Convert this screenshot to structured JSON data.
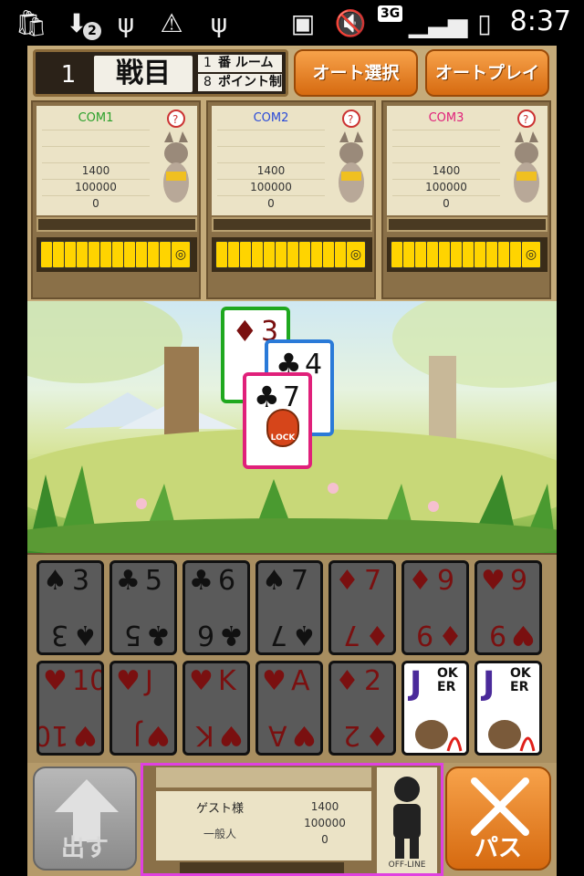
{
  "status_bar": {
    "notification_count": "2",
    "network": "3G",
    "time": "8:37"
  },
  "header": {
    "round_number": "1",
    "round_label": "戦目",
    "rule1_num": "1",
    "rule1_text": "番 ルーム",
    "rule2_num": "8",
    "rule2_text": "ポイント制",
    "auto_select_label": "オート選択",
    "auto_play_label": "オートプレイ"
  },
  "opponents": [
    {
      "name": "COM1",
      "color": "#2aa02a",
      "points": "1400",
      "money": "100000",
      "score": "0",
      "cards": 12
    },
    {
      "name": "COM2",
      "color": "#2a4ad8",
      "points": "1400",
      "money": "100000",
      "score": "0",
      "cards": 12
    },
    {
      "name": "COM3",
      "color": "#e0207a",
      "points": "1400",
      "money": "100000",
      "score": "0",
      "cards": 12
    }
  ],
  "field_cards": [
    {
      "suit": "♦",
      "rank": "3",
      "color": "red",
      "border": "#1fa81f"
    },
    {
      "suit": "♣",
      "rank": "4",
      "color": "black",
      "border": "#2a7ad8"
    },
    {
      "suit": "♣",
      "rank": "7",
      "color": "black",
      "border": "#e0207a",
      "lock": "LOCK"
    }
  ],
  "hand": [
    {
      "suit": "♠",
      "rank": "3",
      "color": "black"
    },
    {
      "suit": "♣",
      "rank": "5",
      "color": "black"
    },
    {
      "suit": "♣",
      "rank": "6",
      "color": "black"
    },
    {
      "suit": "♠",
      "rank": "7",
      "color": "black"
    },
    {
      "suit": "♦",
      "rank": "7",
      "color": "red"
    },
    {
      "suit": "♦",
      "rank": "9",
      "color": "red"
    },
    {
      "suit": "♥",
      "rank": "9",
      "color": "red"
    },
    {
      "suit": "♥",
      "rank": "10",
      "color": "red"
    },
    {
      "suit": "♥",
      "rank": "J",
      "color": "red"
    },
    {
      "suit": "♥",
      "rank": "K",
      "color": "red"
    },
    {
      "suit": "♥",
      "rank": "A",
      "color": "red"
    },
    {
      "suit": "♦",
      "rank": "2",
      "color": "red"
    },
    {
      "joker": true,
      "j": "J",
      "rest": "OK ER"
    },
    {
      "joker": true,
      "j": "J",
      "rest": "OK ER"
    }
  ],
  "player": {
    "name": "ゲスト様",
    "rank": "一般人",
    "points": "1400",
    "money": "100000",
    "score": "0",
    "status": "OFF-LINE"
  },
  "buttons": {
    "play_label": "出す",
    "pass_label": "パス"
  },
  "colors": {
    "accent": "#e07a20",
    "player_border": "#e040e0"
  }
}
